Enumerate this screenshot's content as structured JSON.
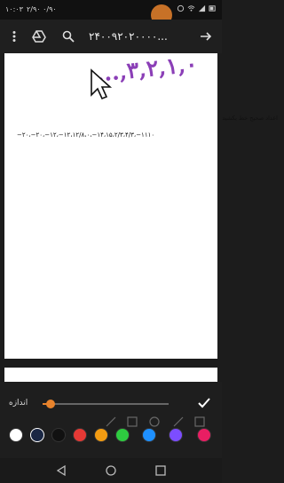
{
  "status_bar": {
    "time": "۱۰:۰۳",
    "speed": "۲/۹۰ ۰/۹۰"
  },
  "toolbar": {
    "title": "۲۴۰۰۹۲۰۲۰۰۰۰...",
    "icons": [
      "more-vert-icon",
      "drive-icon",
      "search-icon",
      "open-external-icon"
    ]
  },
  "document": {
    "handwriting": "...,۳,۲,۱,۰",
    "instruction": "اعداد صحیح خط بکشید",
    "sequence": "−۲۰،−۲۰،−۱۲،−۱۲،۱۲/۸،۰،−۱۴،۱۵،۲/۳،۴/۳،−۱۱۱۰"
  },
  "draw_panel": {
    "size_label": "اندازه",
    "slider_value": 0.06,
    "colors": [
      "#ffffff",
      "#1a2744",
      "#111111",
      "#e53935",
      "#f39c12",
      "#2ecc40",
      "#1e90ff",
      "#7c4dff",
      "#e91e63"
    ],
    "selected_color": "#1a2744"
  }
}
